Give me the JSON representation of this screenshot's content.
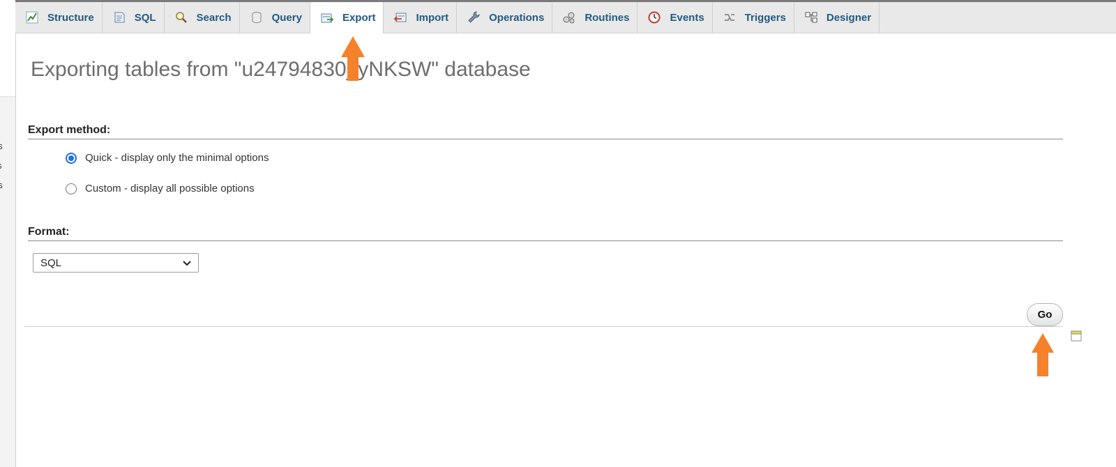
{
  "sidebar": {
    "fragments": [
      "ns",
      "s",
      "os"
    ]
  },
  "tabs": [
    {
      "label": "Structure",
      "icon": "structure-icon"
    },
    {
      "label": "SQL",
      "icon": "sql-icon"
    },
    {
      "label": "Search",
      "icon": "search-icon"
    },
    {
      "label": "Query",
      "icon": "query-icon"
    },
    {
      "label": "Export",
      "icon": "export-icon",
      "active": true
    },
    {
      "label": "Import",
      "icon": "import-icon"
    },
    {
      "label": "Operations",
      "icon": "wrench-icon"
    },
    {
      "label": "Routines",
      "icon": "routines-icon"
    },
    {
      "label": "Events",
      "icon": "clock-icon"
    },
    {
      "label": "Triggers",
      "icon": "triggers-icon"
    },
    {
      "label": "Designer",
      "icon": "designer-icon"
    }
  ],
  "page": {
    "heading": "Exporting tables from \"u24794830_yNKSW\" database"
  },
  "export_method": {
    "label": "Export method:",
    "options": [
      {
        "label": "Quick - display only the minimal options",
        "checked": true
      },
      {
        "label": "Custom - display all possible options",
        "checked": false
      }
    ]
  },
  "format": {
    "label": "Format:",
    "selected": "SQL"
  },
  "actions": {
    "go_label": "Go"
  },
  "colors": {
    "tab_text": "#235a81",
    "annotation_arrow": "#f5822a",
    "radio_accent": "#1a73e8"
  }
}
